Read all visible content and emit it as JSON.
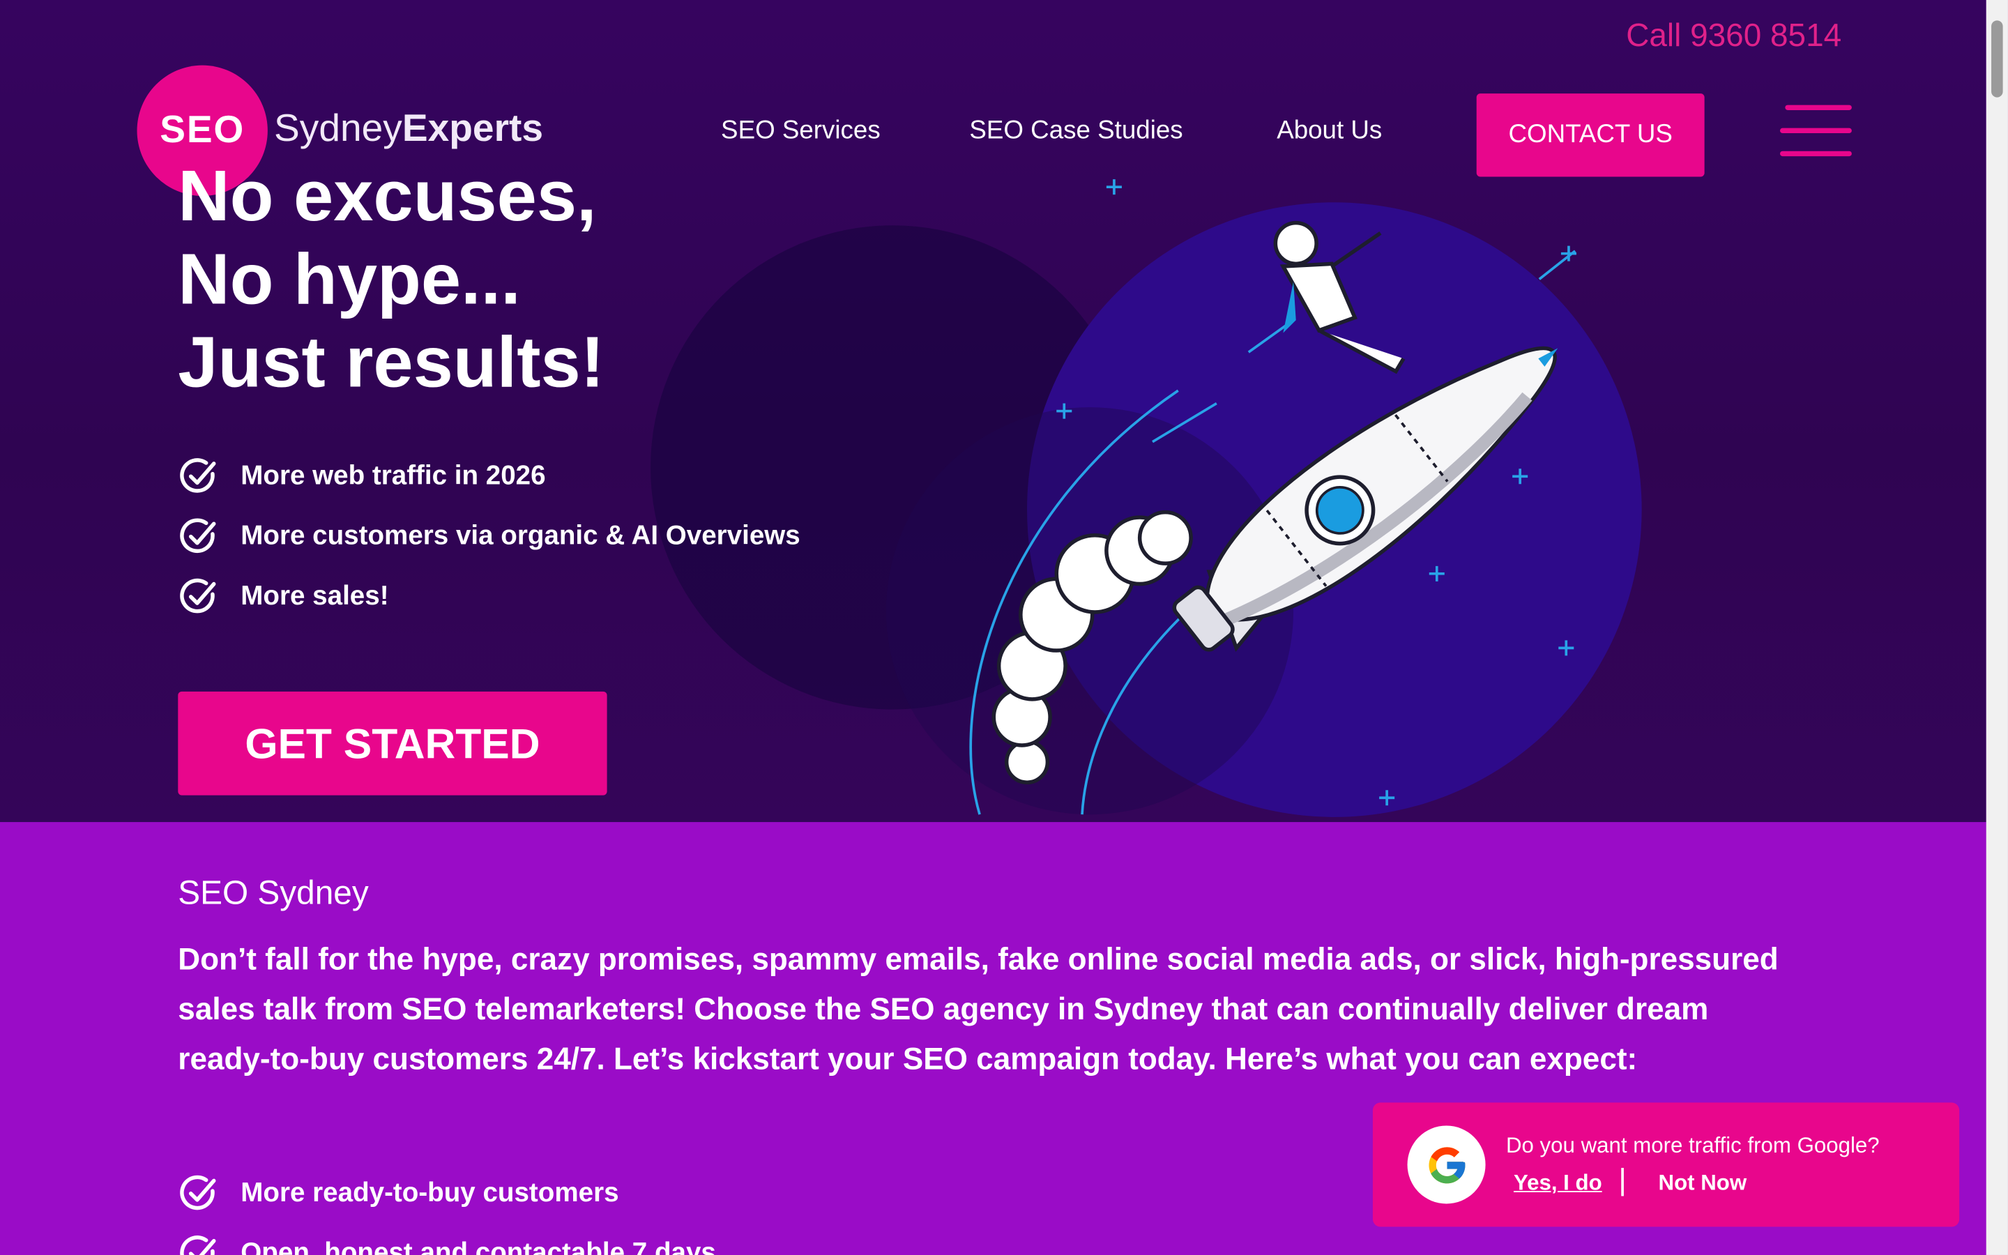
{
  "header": {
    "phone": "Call 9360 8514",
    "logo": {
      "badge": "SEO",
      "word1": "Sydney",
      "word2": "Experts"
    },
    "nav": [
      {
        "label": "SEO Services"
      },
      {
        "label": "SEO Case Studies"
      },
      {
        "label": "About Us"
      }
    ],
    "contact_label": "CONTACT US"
  },
  "hero": {
    "headline": [
      "No excuses,",
      "No hype...",
      "Just results!"
    ],
    "benefits": [
      "More web traffic in 2026",
      "More customers via organic & AI Overviews",
      "More sales!"
    ],
    "cta_label": "GET STARTED"
  },
  "intro": {
    "title": "SEO Sydney",
    "body": "Don’t fall for the hype, crazy promises, spammy emails, fake online social media ads, or slick, high-pressured sales talk from SEO telemarketers! Choose the SEO agency in Sydney that can continually deliver dream ready-to-buy customers 24/7. Let’s kickstart your SEO campaign today. Here’s what you can expect:",
    "expectations": [
      "More ready-to-buy customers",
      "Open, honest and contactable 7 days"
    ]
  },
  "popup": {
    "question": "Do you want more traffic from Google?",
    "yes_label": "Yes, I do",
    "no_label": "Not Now"
  },
  "colors": {
    "brand_pink": "#e8068c",
    "hero_purple": "#2f0452",
    "section_purple": "#9a0cc7",
    "accent_blue": "#29a3e8"
  }
}
